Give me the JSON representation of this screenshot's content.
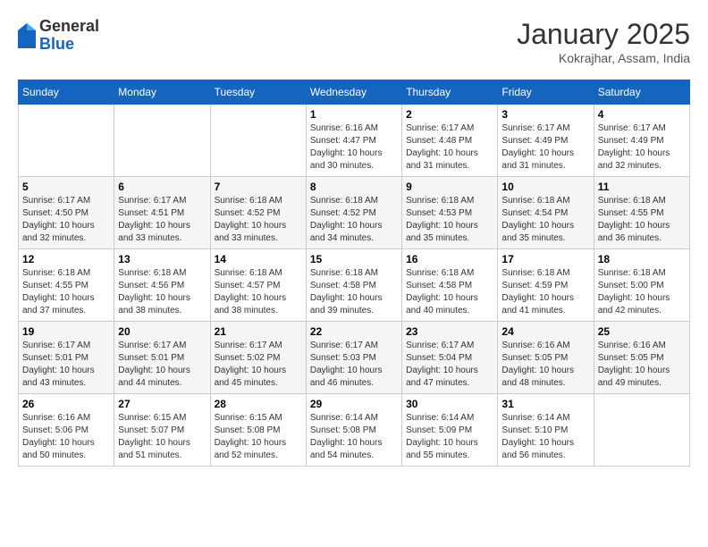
{
  "header": {
    "logo": {
      "general": "General",
      "blue": "Blue"
    },
    "title": "January 2025",
    "location": "Kokrajhar, Assam, India"
  },
  "weekdays": [
    "Sunday",
    "Monday",
    "Tuesday",
    "Wednesday",
    "Thursday",
    "Friday",
    "Saturday"
  ],
  "weeks": [
    [
      {
        "day": "",
        "sunrise": "",
        "sunset": "",
        "daylight": ""
      },
      {
        "day": "",
        "sunrise": "",
        "sunset": "",
        "daylight": ""
      },
      {
        "day": "",
        "sunrise": "",
        "sunset": "",
        "daylight": ""
      },
      {
        "day": "1",
        "sunrise": "Sunrise: 6:16 AM",
        "sunset": "Sunset: 4:47 PM",
        "daylight": "Daylight: 10 hours and 30 minutes."
      },
      {
        "day": "2",
        "sunrise": "Sunrise: 6:17 AM",
        "sunset": "Sunset: 4:48 PM",
        "daylight": "Daylight: 10 hours and 31 minutes."
      },
      {
        "day": "3",
        "sunrise": "Sunrise: 6:17 AM",
        "sunset": "Sunset: 4:49 PM",
        "daylight": "Daylight: 10 hours and 31 minutes."
      },
      {
        "day": "4",
        "sunrise": "Sunrise: 6:17 AM",
        "sunset": "Sunset: 4:49 PM",
        "daylight": "Daylight: 10 hours and 32 minutes."
      }
    ],
    [
      {
        "day": "5",
        "sunrise": "Sunrise: 6:17 AM",
        "sunset": "Sunset: 4:50 PM",
        "daylight": "Daylight: 10 hours and 32 minutes."
      },
      {
        "day": "6",
        "sunrise": "Sunrise: 6:17 AM",
        "sunset": "Sunset: 4:51 PM",
        "daylight": "Daylight: 10 hours and 33 minutes."
      },
      {
        "day": "7",
        "sunrise": "Sunrise: 6:18 AM",
        "sunset": "Sunset: 4:52 PM",
        "daylight": "Daylight: 10 hours and 33 minutes."
      },
      {
        "day": "8",
        "sunrise": "Sunrise: 6:18 AM",
        "sunset": "Sunset: 4:52 PM",
        "daylight": "Daylight: 10 hours and 34 minutes."
      },
      {
        "day": "9",
        "sunrise": "Sunrise: 6:18 AM",
        "sunset": "Sunset: 4:53 PM",
        "daylight": "Daylight: 10 hours and 35 minutes."
      },
      {
        "day": "10",
        "sunrise": "Sunrise: 6:18 AM",
        "sunset": "Sunset: 4:54 PM",
        "daylight": "Daylight: 10 hours and 35 minutes."
      },
      {
        "day": "11",
        "sunrise": "Sunrise: 6:18 AM",
        "sunset": "Sunset: 4:55 PM",
        "daylight": "Daylight: 10 hours and 36 minutes."
      }
    ],
    [
      {
        "day": "12",
        "sunrise": "Sunrise: 6:18 AM",
        "sunset": "Sunset: 4:55 PM",
        "daylight": "Daylight: 10 hours and 37 minutes."
      },
      {
        "day": "13",
        "sunrise": "Sunrise: 6:18 AM",
        "sunset": "Sunset: 4:56 PM",
        "daylight": "Daylight: 10 hours and 38 minutes."
      },
      {
        "day": "14",
        "sunrise": "Sunrise: 6:18 AM",
        "sunset": "Sunset: 4:57 PM",
        "daylight": "Daylight: 10 hours and 38 minutes."
      },
      {
        "day": "15",
        "sunrise": "Sunrise: 6:18 AM",
        "sunset": "Sunset: 4:58 PM",
        "daylight": "Daylight: 10 hours and 39 minutes."
      },
      {
        "day": "16",
        "sunrise": "Sunrise: 6:18 AM",
        "sunset": "Sunset: 4:58 PM",
        "daylight": "Daylight: 10 hours and 40 minutes."
      },
      {
        "day": "17",
        "sunrise": "Sunrise: 6:18 AM",
        "sunset": "Sunset: 4:59 PM",
        "daylight": "Daylight: 10 hours and 41 minutes."
      },
      {
        "day": "18",
        "sunrise": "Sunrise: 6:18 AM",
        "sunset": "Sunset: 5:00 PM",
        "daylight": "Daylight: 10 hours and 42 minutes."
      }
    ],
    [
      {
        "day": "19",
        "sunrise": "Sunrise: 6:17 AM",
        "sunset": "Sunset: 5:01 PM",
        "daylight": "Daylight: 10 hours and 43 minutes."
      },
      {
        "day": "20",
        "sunrise": "Sunrise: 6:17 AM",
        "sunset": "Sunset: 5:01 PM",
        "daylight": "Daylight: 10 hours and 44 minutes."
      },
      {
        "day": "21",
        "sunrise": "Sunrise: 6:17 AM",
        "sunset": "Sunset: 5:02 PM",
        "daylight": "Daylight: 10 hours and 45 minutes."
      },
      {
        "day": "22",
        "sunrise": "Sunrise: 6:17 AM",
        "sunset": "Sunset: 5:03 PM",
        "daylight": "Daylight: 10 hours and 46 minutes."
      },
      {
        "day": "23",
        "sunrise": "Sunrise: 6:17 AM",
        "sunset": "Sunset: 5:04 PM",
        "daylight": "Daylight: 10 hours and 47 minutes."
      },
      {
        "day": "24",
        "sunrise": "Sunrise: 6:16 AM",
        "sunset": "Sunset: 5:05 PM",
        "daylight": "Daylight: 10 hours and 48 minutes."
      },
      {
        "day": "25",
        "sunrise": "Sunrise: 6:16 AM",
        "sunset": "Sunset: 5:05 PM",
        "daylight": "Daylight: 10 hours and 49 minutes."
      }
    ],
    [
      {
        "day": "26",
        "sunrise": "Sunrise: 6:16 AM",
        "sunset": "Sunset: 5:06 PM",
        "daylight": "Daylight: 10 hours and 50 minutes."
      },
      {
        "day": "27",
        "sunrise": "Sunrise: 6:15 AM",
        "sunset": "Sunset: 5:07 PM",
        "daylight": "Daylight: 10 hours and 51 minutes."
      },
      {
        "day": "28",
        "sunrise": "Sunrise: 6:15 AM",
        "sunset": "Sunset: 5:08 PM",
        "daylight": "Daylight: 10 hours and 52 minutes."
      },
      {
        "day": "29",
        "sunrise": "Sunrise: 6:14 AM",
        "sunset": "Sunset: 5:08 PM",
        "daylight": "Daylight: 10 hours and 54 minutes."
      },
      {
        "day": "30",
        "sunrise": "Sunrise: 6:14 AM",
        "sunset": "Sunset: 5:09 PM",
        "daylight": "Daylight: 10 hours and 55 minutes."
      },
      {
        "day": "31",
        "sunrise": "Sunrise: 6:14 AM",
        "sunset": "Sunset: 5:10 PM",
        "daylight": "Daylight: 10 hours and 56 minutes."
      },
      {
        "day": "",
        "sunrise": "",
        "sunset": "",
        "daylight": ""
      }
    ]
  ]
}
